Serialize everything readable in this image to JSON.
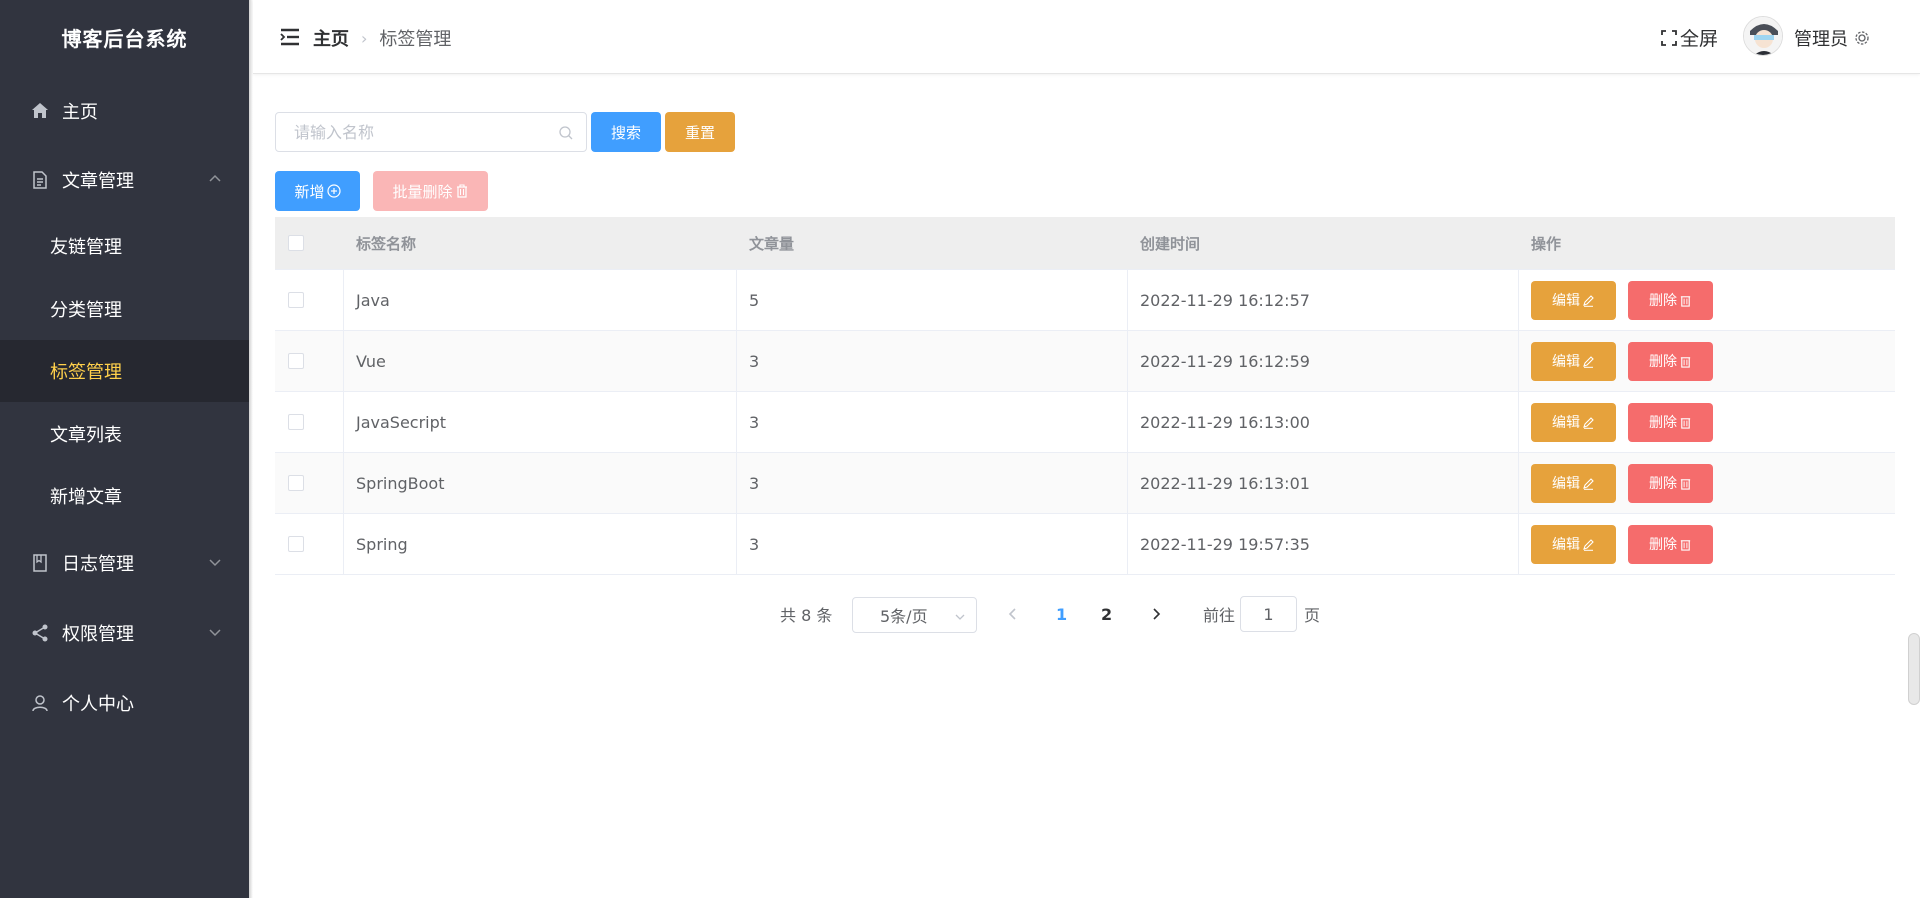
{
  "sidebar": {
    "brand": "博客后台系统",
    "items": [
      {
        "label": "主页",
        "icon": "home-icon"
      },
      {
        "label": "文章管理",
        "icon": "document-icon",
        "expanded": true
      },
      {
        "label": "日志管理",
        "icon": "book-icon"
      },
      {
        "label": "权限管理",
        "icon": "share-icon"
      },
      {
        "label": "个人中心",
        "icon": "user-icon"
      }
    ],
    "subitems": [
      {
        "label": "友链管理"
      },
      {
        "label": "分类管理"
      },
      {
        "label": "标签管理",
        "active": true
      },
      {
        "label": "文章列表"
      },
      {
        "label": "新增文章"
      }
    ],
    "active_color": "#ffd04b",
    "bg_color": "#31343f"
  },
  "header": {
    "breadcrumb_home": "主页",
    "breadcrumb_current": "标签管理",
    "fullscreen_label": "全屏",
    "username": "管理员"
  },
  "toolbar": {
    "search_placeholder": "请输入名称",
    "search_label": "搜索",
    "reset_label": "重置",
    "add_label": "新增",
    "batch_delete_label": "批量删除"
  },
  "table": {
    "headers": {
      "name": "标签名称",
      "count": "文章量",
      "time": "创建时间",
      "ops": "操作"
    },
    "rows": [
      {
        "name": "Java",
        "count": "5",
        "time": "2022-11-29 16:12:57"
      },
      {
        "name": "Vue",
        "count": "3",
        "time": "2022-11-29 16:12:59"
      },
      {
        "name": "JavaSecript",
        "count": "3",
        "time": "2022-11-29 16:13:00"
      },
      {
        "name": "SpringBoot",
        "count": "3",
        "time": "2022-11-29 16:13:01"
      },
      {
        "name": "Spring",
        "count": "3",
        "time": "2022-11-29 19:57:35"
      }
    ],
    "edit_label": "编辑",
    "delete_label": "删除"
  },
  "pagination": {
    "total_text": "共 8 条",
    "page_size": "5条/页",
    "pages": [
      "1",
      "2"
    ],
    "current_page": "1",
    "goto_label": "前往",
    "goto_value": "1",
    "page_suffix": "页"
  },
  "colors": {
    "primary": "#409eff",
    "warning": "#e6a23c",
    "danger": "#f56c6c"
  }
}
